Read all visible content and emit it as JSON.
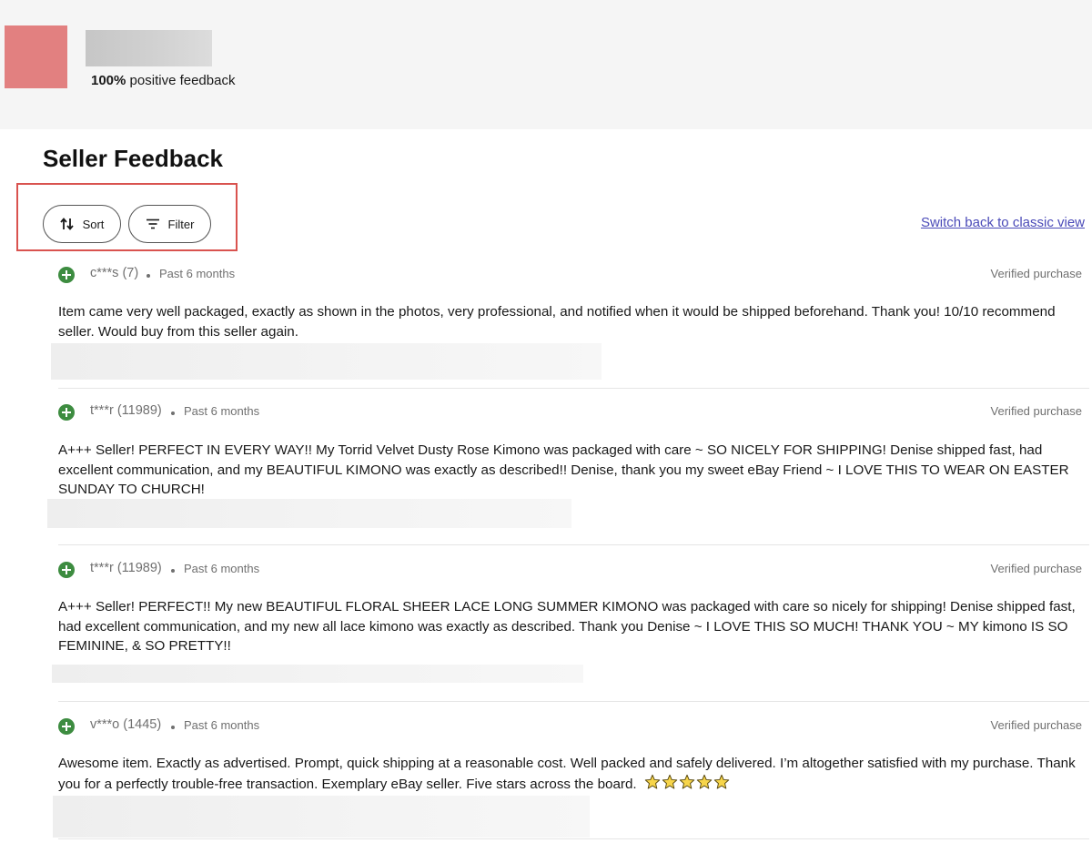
{
  "seller": {
    "positive_percent": "100%",
    "positive_label": "positive feedback"
  },
  "page_title": "Seller Feedback",
  "toolbar": {
    "sort_label": "Sort",
    "filter_label": "Filter",
    "classic_link": "Switch back to classic view"
  },
  "feedback": [
    {
      "user": "c***s (7)",
      "when": "Past 6 months",
      "verified": "Verified purchase",
      "comment": "Item came very well packaged, exactly as shown in the photos, very professional, and notified when it would be shipped beforehand. Thank you! 10/10 recommend seller. Would buy from this seller again."
    },
    {
      "user": "t***r (11989)",
      "when": "Past 6 months",
      "verified": "Verified purchase",
      "comment": "A+++ Seller! PERFECT IN EVERY WAY!! My Torrid Velvet Dusty Rose Kimono was packaged with care ~ SO NICELY FOR SHIPPING! Denise shipped fast, had excellent communication, and my BEAUTIFUL KIMONO was exactly as described!! Denise, thank you my sweet eBay Friend ~ I LOVE THIS TO WEAR ON EASTER SUNDAY TO CHURCH!"
    },
    {
      "user": "t***r (11989)",
      "when": "Past 6 months",
      "verified": "Verified purchase",
      "comment": "A+++ Seller! PERFECT!! My new BEAUTIFUL FLORAL SHEER LACE LONG SUMMER KIMONO was packaged with care so nicely for shipping! Denise shipped fast, had excellent communication, and my new all lace kimono was exactly as described. Thank you Denise ~ I LOVE THIS SO MUCH! THANK YOU ~ MY kimono IS SO FEMININE, & SO PRETTY!!"
    },
    {
      "user": "v***o (1445)",
      "when": "Past 6 months",
      "verified": "Verified purchase",
      "comment": "Awesome item. Exactly as advertised. Prompt, quick shipping at a reasonable cost. Well packed and safely delivered. I’m altogether satisfied with my purchase. Thank you for a perfectly trouble-free transaction. Exemplary eBay seller. Five stars across the board.",
      "emoji_stars": 5
    }
  ],
  "icons": {
    "sort": "sort-arrows-icon",
    "filter": "filter-lines-icon",
    "positive": "plus-circle-icon",
    "star": "star-emoji-icon"
  },
  "colors": {
    "positive_green": "#3d8c40",
    "link": "#4a4ab8",
    "highlight_box": "#d9534f"
  }
}
